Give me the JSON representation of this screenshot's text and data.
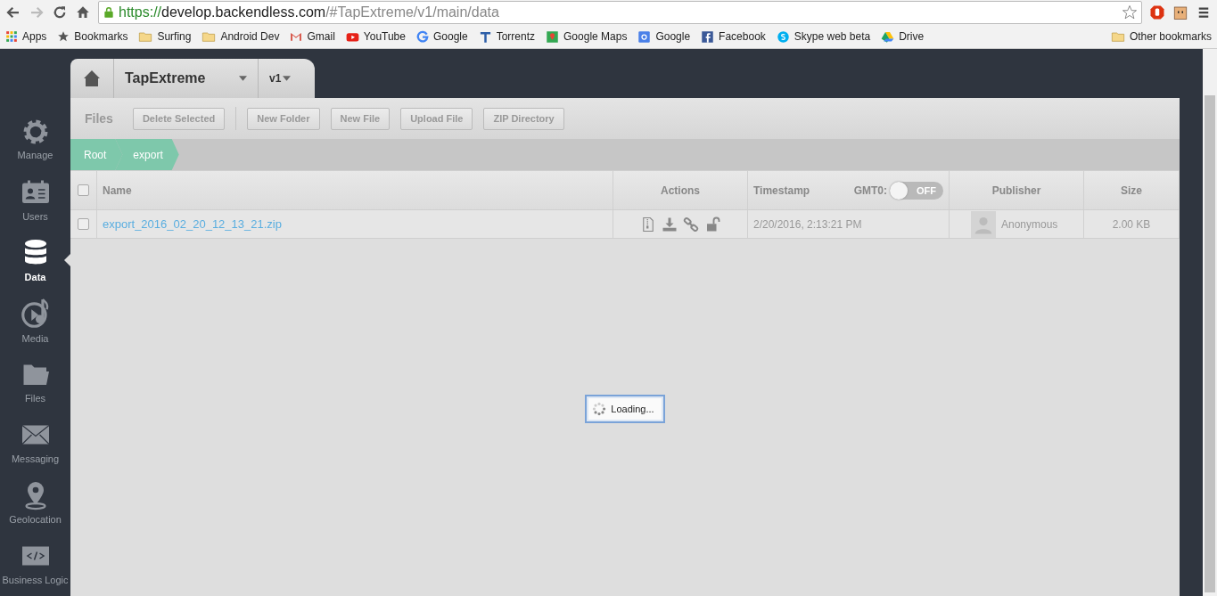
{
  "browser": {
    "url_scheme": "https://",
    "url_host": "develop.backendless.com",
    "url_path": "/#TapExtreme/v1/main/data",
    "bookmarks": [
      {
        "label": "Apps",
        "kind": "apps"
      },
      {
        "label": "Bookmarks",
        "kind": "star"
      },
      {
        "label": "Surfing",
        "kind": "folder"
      },
      {
        "label": "Android Dev",
        "kind": "folder"
      },
      {
        "label": "Gmail",
        "kind": "gmail"
      },
      {
        "label": "YouTube",
        "kind": "youtube"
      },
      {
        "label": "Google",
        "kind": "google"
      },
      {
        "label": "Torrentz",
        "kind": "torrentz"
      },
      {
        "label": "Google Maps",
        "kind": "maps"
      },
      {
        "label": "Google",
        "kind": "gplus"
      },
      {
        "label": "Facebook",
        "kind": "facebook"
      },
      {
        "label": "Skype web beta",
        "kind": "skype"
      },
      {
        "label": "Drive",
        "kind": "drive"
      }
    ],
    "other_bookmarks": "Other bookmarks"
  },
  "sidebar": {
    "items": [
      {
        "label": "Manage",
        "kind": "gear",
        "selected": false
      },
      {
        "label": "Users",
        "kind": "users",
        "selected": false
      },
      {
        "label": "Data",
        "kind": "data",
        "selected": true
      },
      {
        "label": "Media",
        "kind": "media",
        "selected": false
      },
      {
        "label": "Files",
        "kind": "files",
        "selected": false
      },
      {
        "label": "Messaging",
        "kind": "messaging",
        "selected": false
      },
      {
        "label": "Geolocation",
        "kind": "geo",
        "selected": false
      },
      {
        "label": "Business Logic",
        "kind": "code",
        "selected": false
      }
    ]
  },
  "app_bar": {
    "app_name": "TapExtreme",
    "version": "v1"
  },
  "toolbar": {
    "title": "Files",
    "buttons": [
      "Delete Selected",
      "New Folder",
      "New File",
      "Upload File",
      "ZIP Directory"
    ]
  },
  "breadcrumb": [
    "Root",
    "export"
  ],
  "table": {
    "columns": [
      "Name",
      "Actions",
      "Timestamp",
      "Publisher",
      "Size"
    ],
    "select_all": {
      "checked": false
    },
    "gmt_label": "GMT0:",
    "gmt_toggle": {
      "on": false,
      "off_label": "OFF"
    },
    "rows": [
      {
        "checked": false,
        "name": "export_2016_02_20_12_13_21.zip",
        "timestamp": "2/20/2016, 2:13:21 PM",
        "publisher": "Anonymous",
        "size": "2.00 KB"
      }
    ]
  },
  "loading": "Loading..."
}
